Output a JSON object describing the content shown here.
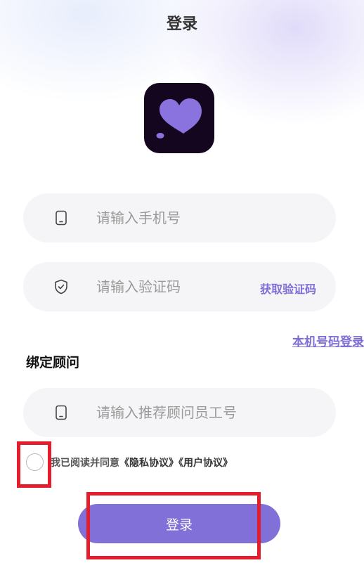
{
  "header": {
    "title": "登录"
  },
  "logo": {
    "icon": "heart-app-logo",
    "bg_color": "#14061e",
    "heart_color": "#8a73df"
  },
  "phone": {
    "placeholder": "请输入手机号",
    "icon": "phone-icon"
  },
  "code": {
    "placeholder": "请输入验证码",
    "icon": "shield-icon",
    "get_code_label": "获取验证码"
  },
  "local_login": {
    "label": "本机号码登录"
  },
  "advisor": {
    "section_label": "绑定顾问",
    "placeholder": "请输入推荐顾问员工号",
    "icon": "phone-icon"
  },
  "agreement": {
    "prefix": "我已阅读并同意",
    "privacy": "《隐私协议》",
    "user": "《用户协议》",
    "checked": false
  },
  "login_button": {
    "label": "登录"
  },
  "colors": {
    "accent": "#8270d9",
    "link": "#7e6ed6",
    "highlight": "#e31d2b"
  }
}
